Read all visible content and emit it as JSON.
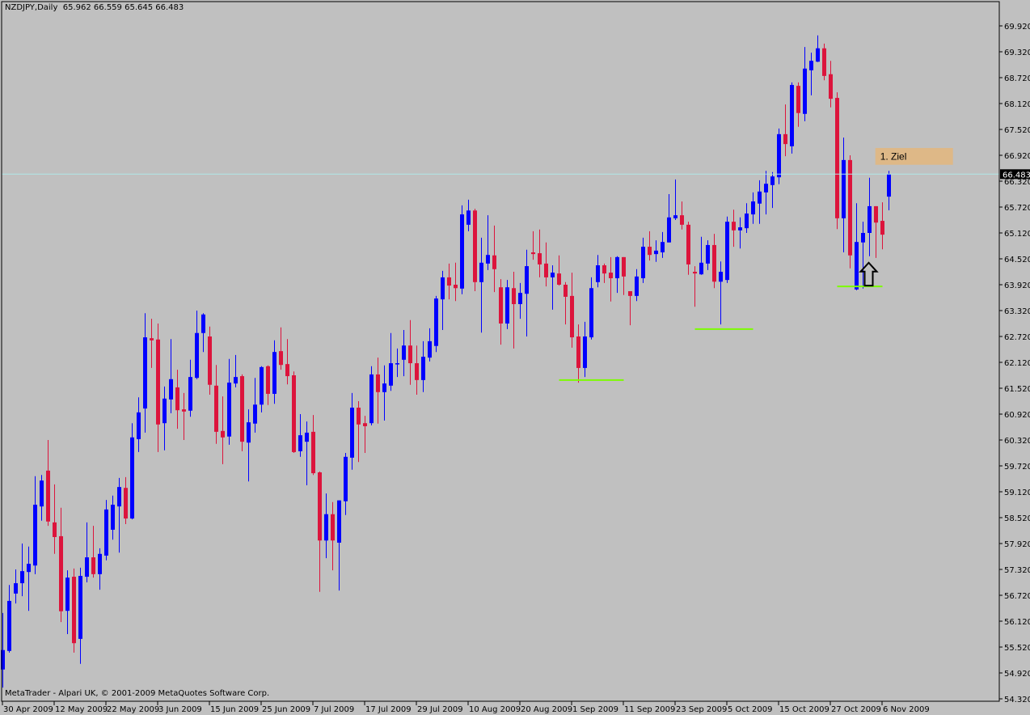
{
  "header": {
    "symbol": "NZDJPY,Daily",
    "ohlc_text": "65.962 66.559 65.645 66.483"
  },
  "footer": {
    "copyright": "MetaTrader - Alpari UK, © 2001-2009 MetaQuotes Software Corp."
  },
  "colors": {
    "background": "#C0C0C0",
    "bull": "#0000FF",
    "bear": "#DC143C",
    "level_line": "#B0E8E8",
    "support": "#7CFC00",
    "target_box": "#DEB887"
  },
  "chart_data": {
    "type": "candlestick",
    "title": "NZDJPY,Daily",
    "ylim": [
      54.32,
      69.92
    ],
    "yticks": [
      "69.920",
      "69.320",
      "68.720",
      "68.120",
      "67.520",
      "66.920",
      "66.320",
      "65.720",
      "65.120",
      "64.520",
      "63.920",
      "63.320",
      "62.720",
      "62.120",
      "61.520",
      "60.920",
      "60.320",
      "59.720",
      "59.120",
      "58.520",
      "57.920",
      "57.320",
      "56.720",
      "56.120",
      "55.520",
      "54.920",
      "54.320"
    ],
    "current_price": "66.483",
    "xtick_bars": [
      0,
      8,
      16,
      24,
      32,
      40,
      48,
      56,
      64,
      72,
      80,
      88,
      96,
      104,
      112,
      120,
      128,
      136
    ],
    "xtick_labels": [
      "30 Apr 2009",
      "12 May 2009",
      "22 May 2009",
      "3 Jun 2009",
      "15 Jun 2009",
      "25 Jun 2009",
      "7 Jul 2009",
      "17 Jul 2009",
      "29 Jul 2009",
      "10 Aug 2009",
      "20 Aug 2009",
      "1 Sep 2009",
      "11 Sep 2009",
      "23 Sep 2009",
      "5 Oct 2009",
      "15 Oct 2009",
      "27 Oct 2009",
      "6 Nov 2009"
    ],
    "ohlc": [
      [
        55.0,
        56.31,
        54.58,
        55.45
      ],
      [
        55.43,
        56.96,
        55.39,
        56.59
      ],
      [
        56.76,
        57.32,
        56.53,
        57.0
      ],
      [
        57.0,
        57.92,
        56.7,
        57.28
      ],
      [
        57.26,
        57.85,
        56.36,
        57.45
      ],
      [
        57.41,
        59.48,
        57.21,
        58.82
      ],
      [
        58.78,
        59.51,
        58.45,
        59.38
      ],
      [
        59.61,
        60.32,
        58.33,
        58.43
      ],
      [
        58.41,
        59.29,
        57.68,
        58.07
      ],
      [
        58.09,
        58.75,
        56.1,
        56.35
      ],
      [
        56.36,
        57.3,
        55.82,
        57.13
      ],
      [
        57.15,
        57.34,
        55.39,
        55.61
      ],
      [
        55.71,
        57.36,
        55.13,
        57.17
      ],
      [
        57.15,
        58.41,
        57.02,
        57.6
      ],
      [
        57.6,
        58.33,
        57.13,
        57.21
      ],
      [
        57.21,
        57.81,
        56.85,
        57.68
      ],
      [
        57.64,
        58.93,
        57.53,
        58.71
      ],
      [
        58.24,
        59.03,
        58.01,
        58.82
      ],
      [
        58.78,
        59.44,
        57.71,
        59.23
      ],
      [
        59.21,
        59.46,
        58.37,
        58.5
      ],
      [
        58.5,
        60.71,
        58.48,
        60.38
      ],
      [
        60.34,
        61.31,
        60.04,
        60.96
      ],
      [
        61.05,
        63.26,
        60.49,
        62.7
      ],
      [
        62.68,
        63.13,
        61.99,
        62.63
      ],
      [
        62.65,
        63.02,
        60.04,
        60.68
      ],
      [
        60.71,
        61.56,
        60.08,
        61.28
      ],
      [
        61.26,
        62.66,
        60.94,
        61.73
      ],
      [
        61.54,
        61.95,
        60.58,
        61.01
      ],
      [
        61.03,
        61.41,
        60.32,
        60.98
      ],
      [
        61.0,
        62.18,
        60.86,
        61.78
      ],
      [
        61.76,
        63.32,
        61.73,
        62.8
      ],
      [
        62.8,
        63.26,
        62.36,
        63.23
      ],
      [
        62.72,
        62.95,
        61.37,
        61.6
      ],
      [
        61.58,
        62.06,
        60.23,
        60.51
      ],
      [
        60.53,
        61.33,
        59.76,
        60.38
      ],
      [
        60.4,
        62.2,
        60.21,
        61.65
      ],
      [
        61.63,
        62.29,
        61.54,
        61.78
      ],
      [
        61.8,
        61.84,
        60.06,
        60.28
      ],
      [
        60.26,
        61.03,
        59.36,
        60.73
      ],
      [
        60.7,
        61.76,
        60.49,
        61.14
      ],
      [
        61.14,
        62.03,
        60.96,
        62.01
      ],
      [
        62.03,
        62.05,
        61.13,
        61.39
      ],
      [
        61.39,
        62.63,
        61.16,
        62.36
      ],
      [
        62.38,
        62.93,
        61.95,
        62.06
      ],
      [
        62.08,
        62.66,
        61.61,
        61.8
      ],
      [
        61.82,
        61.91,
        60.02,
        60.04
      ],
      [
        60.06,
        60.92,
        59.93,
        60.43
      ],
      [
        60.28,
        60.75,
        59.27,
        60.49
      ],
      [
        60.51,
        60.9,
        59.51,
        59.55
      ],
      [
        59.57,
        59.59,
        56.8,
        57.99
      ],
      [
        57.99,
        59.08,
        57.58,
        58.6
      ],
      [
        58.6,
        58.88,
        57.3,
        57.99
      ],
      [
        57.94,
        58.92,
        56.83,
        58.92
      ],
      [
        58.9,
        60.02,
        58.58,
        59.93
      ],
      [
        59.91,
        61.41,
        59.63,
        61.07
      ],
      [
        61.07,
        61.22,
        59.81,
        60.68
      ],
      [
        60.71,
        60.88,
        60.02,
        60.64
      ],
      [
        60.71,
        62.03,
        60.66,
        61.84
      ],
      [
        61.84,
        62.23,
        60.7,
        61.43
      ],
      [
        61.43,
        62.05,
        60.77,
        61.63
      ],
      [
        61.58,
        62.8,
        61.46,
        62.1
      ],
      [
        62.08,
        62.44,
        61.78,
        62.1
      ],
      [
        62.18,
        62.87,
        61.8,
        62.51
      ],
      [
        62.51,
        63.1,
        61.6,
        62.1
      ],
      [
        62.1,
        62.51,
        61.37,
        61.71
      ],
      [
        61.71,
        62.61,
        61.43,
        62.25
      ],
      [
        62.23,
        62.91,
        62.14,
        62.61
      ],
      [
        62.5,
        63.66,
        62.36,
        63.6
      ],
      [
        63.58,
        64.24,
        62.87,
        64.09
      ],
      [
        64.09,
        64.41,
        63.58,
        63.9
      ],
      [
        63.92,
        64.43,
        63.54,
        63.84
      ],
      [
        63.83,
        65.76,
        63.7,
        65.55
      ],
      [
        65.31,
        65.89,
        65.16,
        65.64
      ],
      [
        65.64,
        65.68,
        63.77,
        63.98
      ],
      [
        63.98,
        65.01,
        62.81,
        64.43
      ],
      [
        64.41,
        65.53,
        64.26,
        64.61
      ],
      [
        64.6,
        65.29,
        63.75,
        64.28
      ],
      [
        63.86,
        64.05,
        62.53,
        63.02
      ],
      [
        63.02,
        64.03,
        62.89,
        63.86
      ],
      [
        63.84,
        64.22,
        62.44,
        63.47
      ],
      [
        63.47,
        63.96,
        63.13,
        63.73
      ],
      [
        63.71,
        64.73,
        62.72,
        64.35
      ],
      [
        64.67,
        65.16,
        64.5,
        64.63
      ],
      [
        64.65,
        65.2,
        64.09,
        64.39
      ],
      [
        64.41,
        64.9,
        63.88,
        64.09
      ],
      [
        64.09,
        64.37,
        63.34,
        64.2
      ],
      [
        64.18,
        64.6,
        63.9,
        63.92
      ],
      [
        63.92,
        63.98,
        63.0,
        63.64
      ],
      [
        63.66,
        64.2,
        62.46,
        62.7
      ],
      [
        62.72,
        63.0,
        61.65,
        61.99
      ],
      [
        61.99,
        63.06,
        61.78,
        62.72
      ],
      [
        62.7,
        64.09,
        62.65,
        63.84
      ],
      [
        63.98,
        64.61,
        63.86,
        64.37
      ],
      [
        64.37,
        64.41,
        63.96,
        64.18
      ],
      [
        64.2,
        64.56,
        63.53,
        64.07
      ],
      [
        64.07,
        64.58,
        63.73,
        64.56
      ],
      [
        64.56,
        64.56,
        63.68,
        64.11
      ],
      [
        63.77,
        63.77,
        62.98,
        63.66
      ],
      [
        63.66,
        64.28,
        63.54,
        64.11
      ],
      [
        64.07,
        65.01,
        63.96,
        64.8
      ],
      [
        64.8,
        65.16,
        64.48,
        64.61
      ],
      [
        64.63,
        64.95,
        64.45,
        64.71
      ],
      [
        64.67,
        65.14,
        64.54,
        64.91
      ],
      [
        64.9,
        66.02,
        64.9,
        65.48
      ],
      [
        65.46,
        66.36,
        65.42,
        65.53
      ],
      [
        65.53,
        65.85,
        65.2,
        65.31
      ],
      [
        65.31,
        65.38,
        64.15,
        64.39
      ],
      [
        64.22,
        64.35,
        63.41,
        64.18
      ],
      [
        64.16,
        65.03,
        64.15,
        64.43
      ],
      [
        64.41,
        64.95,
        64.26,
        64.84
      ],
      [
        64.84,
        65.1,
        63.84,
        63.99
      ],
      [
        63.99,
        64.46,
        63.0,
        64.22
      ],
      [
        64.03,
        65.5,
        63.96,
        65.38
      ],
      [
        65.38,
        65.66,
        64.8,
        65.18
      ],
      [
        65.18,
        65.48,
        64.76,
        65.25
      ],
      [
        65.23,
        65.81,
        65.12,
        65.57
      ],
      [
        65.55,
        66.06,
        65.33,
        65.85
      ],
      [
        65.8,
        66.34,
        65.33,
        66.08
      ],
      [
        66.06,
        66.56,
        65.55,
        66.26
      ],
      [
        66.23,
        66.53,
        65.7,
        66.43
      ],
      [
        66.41,
        67.54,
        66.25,
        67.41
      ],
      [
        67.41,
        68.1,
        66.9,
        67.18
      ],
      [
        67.13,
        68.61,
        66.96,
        68.55
      ],
      [
        68.53,
        68.61,
        67.58,
        67.9
      ],
      [
        67.88,
        69.43,
        67.71,
        68.93
      ],
      [
        68.89,
        69.3,
        68.31,
        69.11
      ],
      [
        69.09,
        69.7,
        69.08,
        69.4
      ],
      [
        69.4,
        69.51,
        68.66,
        68.76
      ],
      [
        68.8,
        69.11,
        68.03,
        68.23
      ],
      [
        68.25,
        68.38,
        65.21,
        65.46
      ],
      [
        65.46,
        67.33,
        64.67,
        66.81
      ],
      [
        66.81,
        66.92,
        64.3,
        64.6
      ],
      [
        63.81,
        65.81,
        63.79,
        64.91
      ],
      [
        64.9,
        65.38,
        63.83,
        65.12
      ],
      [
        65.12,
        66.4,
        64.58,
        65.74
      ],
      [
        65.74,
        65.74,
        64.54,
        65.36
      ],
      [
        65.4,
        65.83,
        64.74,
        65.08
      ],
      [
        65.962,
        66.559,
        65.645,
        66.483
      ]
    ],
    "support_lines": [
      {
        "price": 61.71,
        "from_bar": 86,
        "to_bar": 96
      },
      {
        "price": 62.89,
        "from_bar": 107,
        "to_bar": 116
      },
      {
        "price": 63.88,
        "from_bar": 129,
        "to_bar": 136
      }
    ],
    "target_box": {
      "label": "1. Ziel",
      "price_top": 67.09,
      "price_bottom": 66.7,
      "from_bar": 134.9,
      "to_bar": 146.9
    },
    "arrow": {
      "direction": "up",
      "bar": 134,
      "price_top": 64.43,
      "price_bottom": 63.9
    }
  }
}
